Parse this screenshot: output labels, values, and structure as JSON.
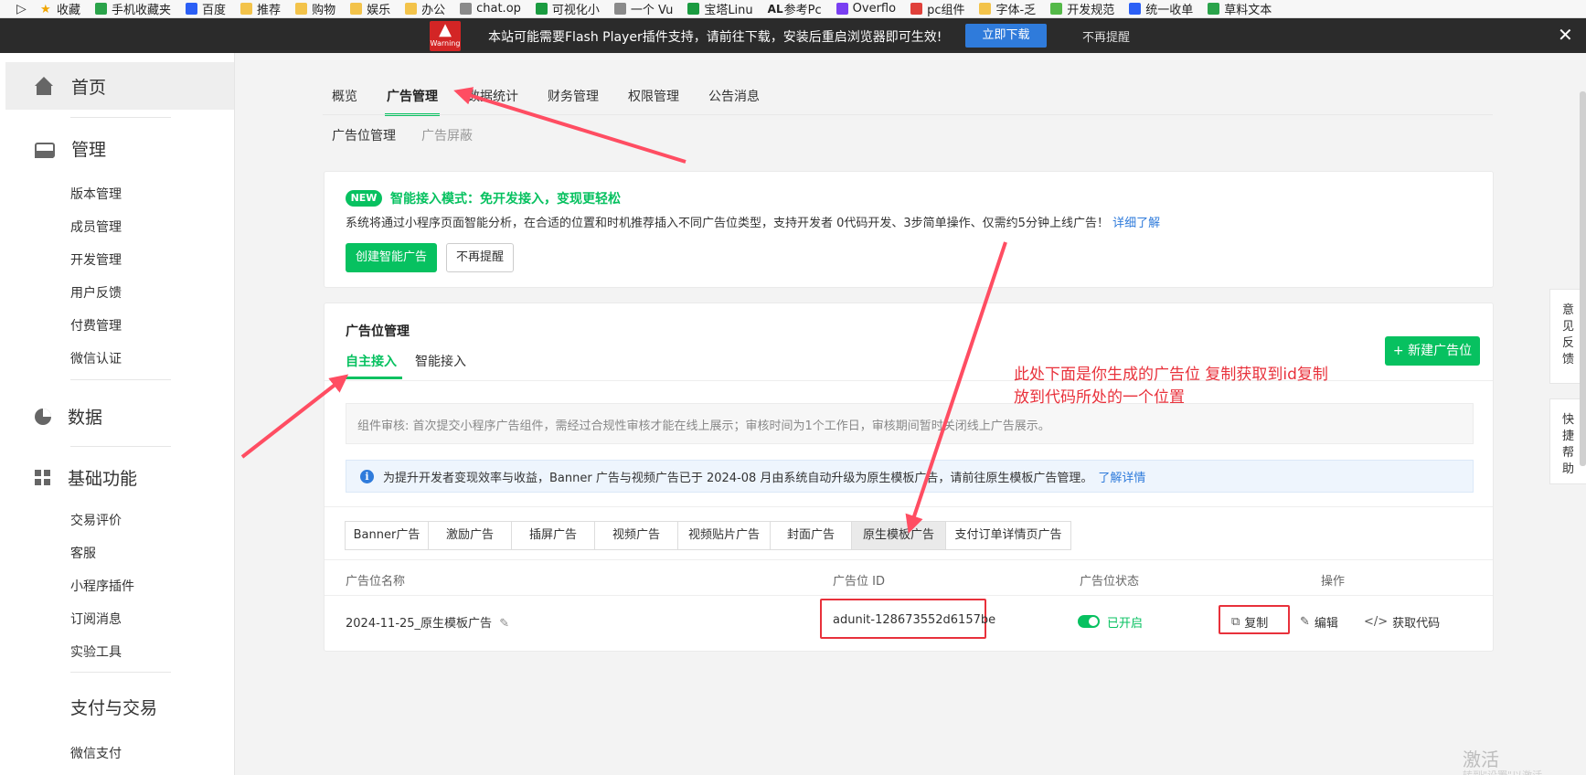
{
  "bookmarks": [
    {
      "label": "收藏",
      "icon": "star-icon"
    },
    {
      "label": "手机收藏夹",
      "icon": "phone-icon"
    },
    {
      "label": "百度",
      "icon": "baidu-icon"
    },
    {
      "label": "推荐",
      "icon": "folder-icon"
    },
    {
      "label": "购物",
      "icon": "folder-icon"
    },
    {
      "label": "娱乐",
      "icon": "folder-icon"
    },
    {
      "label": "办公",
      "icon": "folder-icon"
    },
    {
      "label": "chat.op",
      "icon": "globe-icon"
    },
    {
      "label": "可视化小",
      "icon": "app-icon"
    },
    {
      "label": "一个 Vu",
      "icon": "globe-icon"
    },
    {
      "label": "宝塔Linu",
      "icon": "app-icon"
    },
    {
      "label": "参考Pc",
      "icon": "text-icon"
    },
    {
      "label": "Overflo",
      "icon": "bootstrap-icon"
    },
    {
      "label": "pc组件",
      "icon": "red-icon"
    },
    {
      "label": "字体-乏",
      "icon": "app-icon"
    },
    {
      "label": "开发规范",
      "icon": "app-icon"
    },
    {
      "label": "统一收单",
      "icon": "alipay-icon"
    },
    {
      "label": "草料文本",
      "icon": "qr-icon"
    }
  ],
  "flash_banner": {
    "warning_label": "Warning",
    "message": "本站可能需要Flash Player插件支持，请前往下载，安装后重启浏览器即可生效!",
    "download_button": "立即下载",
    "dismiss": "不再提醒",
    "close": "✕"
  },
  "sidebar": {
    "groups": [
      {
        "label": "首页",
        "icon": "home-icon",
        "items": []
      },
      {
        "label": "管理",
        "icon": "inbox-icon",
        "items": [
          "版本管理",
          "成员管理",
          "开发管理",
          "用户反馈",
          "付费管理",
          "微信认证"
        ]
      },
      {
        "label": "数据",
        "icon": "pie-chart-icon",
        "items": []
      },
      {
        "label": "基础功能",
        "icon": "grid-icon",
        "items": [
          "交易评价",
          "客服",
          "小程序插件",
          "订阅消息",
          "实验工具"
        ]
      },
      {
        "label": "支付与交易",
        "icon": "",
        "items": [
          "微信支付"
        ]
      }
    ]
  },
  "top_nav": {
    "tabs": [
      "概览",
      "广告管理",
      "数据统计",
      "财务管理",
      "权限管理",
      "公告消息"
    ],
    "active": "广告管理",
    "sub_tabs": [
      "广告位管理",
      "广告屏蔽"
    ]
  },
  "smart_access": {
    "badge": "NEW",
    "title": "智能接入模式：免开发接入，变现更轻松",
    "description": "系统将通过小程序页面智能分析，在合适的位置和时机推荐插入不同广告位类型，支持开发者 0代码开发、3步简单操作、仅需约5分钟上线广告！",
    "learn_more": "详细了解",
    "create_button": "创建智能广告",
    "dismiss_button": "不再提醒"
  },
  "ad_management": {
    "title": "广告位管理",
    "tabs": [
      "自主接入",
      "智能接入"
    ],
    "active_tab": "自主接入",
    "new_button": "+ 新建广告位",
    "review_note": "组件审核: 首次提交小程序广告组件，需经过合规性审核才能在线上展示；审核时间为1个工作日，审核期间暂时关闭线上广告展示。",
    "notice": "为提升开发者变现效率与收益，Banner 广告与视频广告已于 2024-08 月由系统自动升级为原生模板广告，请前往原生模板广告管理。",
    "notice_link": "了解详情",
    "ad_types": [
      "Banner广告",
      "激励广告",
      "插屏广告",
      "视频广告",
      "视频贴片广告",
      "封面广告",
      "原生模板广告",
      "支付订单详情页广告"
    ],
    "active_type": "原生模板广告",
    "columns": [
      "广告位名称",
      "广告位 ID",
      "广告位状态",
      "操作"
    ],
    "rows": [
      {
        "name": "2024-11-25_原生模板广告",
        "id": "adunit-128673552d6157be",
        "status": "已开启",
        "status_on": true,
        "actions": [
          "复制",
          "编辑",
          "获取代码"
        ]
      }
    ]
  },
  "annotation": {
    "line1": "此处下面是你生成的广告位 复制获取到id复制",
    "line2": "放到代码所处的一个位置"
  },
  "float_panel": {
    "feedback": "意见反馈",
    "help": "快捷帮助"
  },
  "watermark": {
    "title": "激活 Windows",
    "subtitle": "转到\"设置\"以激活 Windows。"
  },
  "colors": {
    "accent": "#07c160",
    "annotation": "#e8313b",
    "link": "#2f7bdb",
    "banner_bg": "#2b2b2b"
  }
}
